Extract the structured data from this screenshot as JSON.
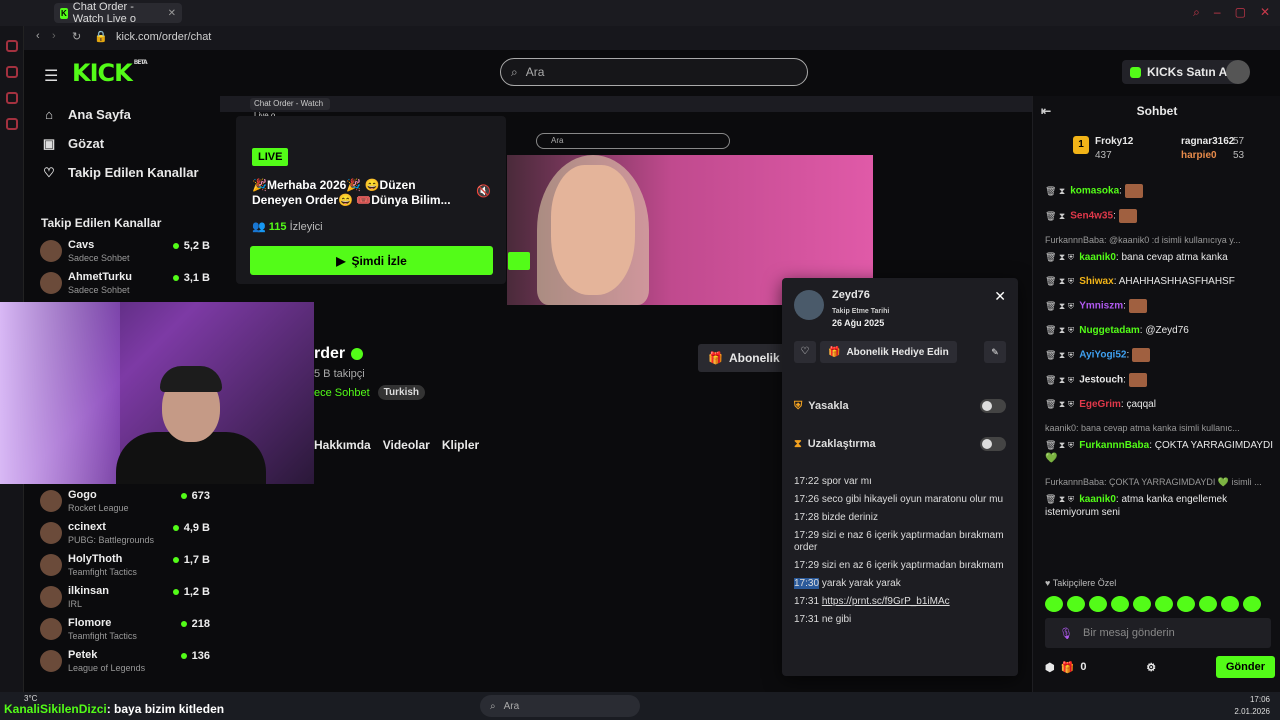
{
  "browser": {
    "tab_title": "Chat Order - Watch Live o",
    "url": "kick.com/order/chat"
  },
  "header": {
    "logo": "KICK",
    "logo_beta": "BETA",
    "search_placeholder": "Ara",
    "buy_label": "KICKs Satın Al"
  },
  "nav": {
    "items": [
      {
        "icon": "home-icon",
        "label": "Ana Sayfa"
      },
      {
        "icon": "compass-icon",
        "label": "Gözat"
      },
      {
        "icon": "heart-icon",
        "label": "Takip Edilen Kanallar"
      }
    ],
    "followed_heading": "Takip Edilen Kanallar"
  },
  "channels": [
    {
      "name": "Cavs",
      "sub": "Sadece Sohbet",
      "viewers": "5,2 B"
    },
    {
      "name": "AhmetTurku",
      "sub": "Sadece Sohbet",
      "viewers": "3,1 B"
    },
    {
      "name": "Gogo",
      "sub": "Rocket League",
      "viewers": "673"
    },
    {
      "name": "ccinext",
      "sub": "PUBG: Battlegrounds",
      "viewers": "4,9 B"
    },
    {
      "name": "HolyThoth",
      "sub": "Teamfight Tactics",
      "viewers": "1,7 B"
    },
    {
      "name": "ilkinsan",
      "sub": "IRL",
      "viewers": "1,2 B"
    },
    {
      "name": "Flomore",
      "sub": "Teamfight Tactics",
      "viewers": "218"
    },
    {
      "name": "Petek",
      "sub": "League of Legends",
      "viewers": "136"
    }
  ],
  "live_card": {
    "badge": "LIVE",
    "title": "🎉Merhaba 2026🎉 😄Düzen Deneyen Order😄 🎟️Dünya Bilim...",
    "viewers_count": "115",
    "viewers_label": "İzleyici",
    "watch_label": "Şimdi İzle"
  },
  "channel": {
    "name": "rder",
    "followers": "5 B takipçi",
    "category": "ece Sohbet",
    "tag": "Turkish",
    "tabs": [
      "Hakkımda",
      "Videolar",
      "Klipler"
    ],
    "subscribe_label": "Abonelik"
  },
  "popup": {
    "username": "Zeyd76",
    "follow_label": "Takip Etme Tarihi",
    "follow_date": "26 Ağu 2025",
    "gift_label": "Abonelik Hediye Edin",
    "ban_label": "Yasakla",
    "timeout_label": "Uzaklaştırma",
    "messages": [
      {
        "time": "17:22",
        "text": "spor var mı"
      },
      {
        "time": "17:26",
        "text": "seco gibi hikayeli oyun maratonu olur mu"
      },
      {
        "time": "17:28",
        "text": "bizde deriniz"
      },
      {
        "time": "17:29",
        "text": "sizi e naz 6 içerik yaptırmadan bırakmam order"
      },
      {
        "time": "17:29",
        "text": "sizi en az 6 içerik yaptırmadan bırakmam"
      },
      {
        "time": "17:30",
        "text": "yarak yarak yarak"
      },
      {
        "time": "17:31",
        "text": "https://prnt.sc/f9GrP_b1iMAc"
      },
      {
        "time": "17:31",
        "text": "ne gibi"
      }
    ]
  },
  "chat": {
    "title": "Sohbet",
    "top_gifters": [
      {
        "name": "Froky12",
        "count": "437"
      },
      {
        "name": "ragnar3162",
        "count": "57"
      },
      {
        "name": "harpie0",
        "count": "53"
      }
    ],
    "messages": [
      {
        "user": "komasoka",
        "text": "",
        "color": "#53fc18",
        "emote": true
      },
      {
        "user": "Sen4w35",
        "text": "",
        "color": "#e0384a",
        "emote": true
      },
      {
        "reply": "FurkannnBaba: @kaanik0 :d isimli kullanıcıya y..."
      },
      {
        "user": "",
        "text": "atma kanka",
        "color": "#e8e8e8",
        "prefix": "Sen4w35 (cont.)"
      },
      {
        "user": "Shiwax",
        "text": "AHAHHASHHASFHAHSF",
        "color": "#f2b418"
      },
      {
        "user": "Ymniszm",
        "text": "",
        "color": "#b05af0",
        "emote": true
      },
      {
        "user": "Nuggetadam",
        "text": "@Zeyd76",
        "color": "#53fc18"
      },
      {
        "user": "AyiYogi52",
        "text": "",
        "color": "#3fa0f0",
        "emote": true
      },
      {
        "user": "Jestouch",
        "text": "",
        "color": "#e8e8e8",
        "emote": true
      },
      {
        "user": "EgeGrim",
        "text": "çaqqal",
        "color": "#e0384a"
      },
      {
        "reply": "kaanik0: bana cevap atma kanka isimli kullanıc..."
      },
      {
        "user": "FurkannnBaba",
        "text": "ÇOKTA YARRAGIMDAYDI 💚",
        "color": "#53fc18"
      },
      {
        "reply": "FurkannnBaba: ÇOKTA YARRAGIMDAYDI 💚 isimli ..."
      },
      {
        "user": "kaanik0",
        "text": "atma kanka engellemek istemiyorum seni",
        "color": "#53fc18"
      },
      {
        "user": "KanaliSikilenDizci",
        "text": "baya bizim kitleden",
        "color": "#53fc18"
      }
    ],
    "first_msg": {
      "user": "kaanik0",
      "text": "bana cevap"
    },
    "sub_only": "Takipçilere Özel",
    "input_placeholder": "Bir mesaj gönderin",
    "points": "0",
    "send_label": "Gönder"
  },
  "overlay": {
    "user": "KanaliSikilenDizci",
    "text": ": baya bizim kitleden"
  },
  "taskbar": {
    "search": "Ara",
    "time": "17:06",
    "date": "2.01.2026",
    "weather": "3°C"
  }
}
